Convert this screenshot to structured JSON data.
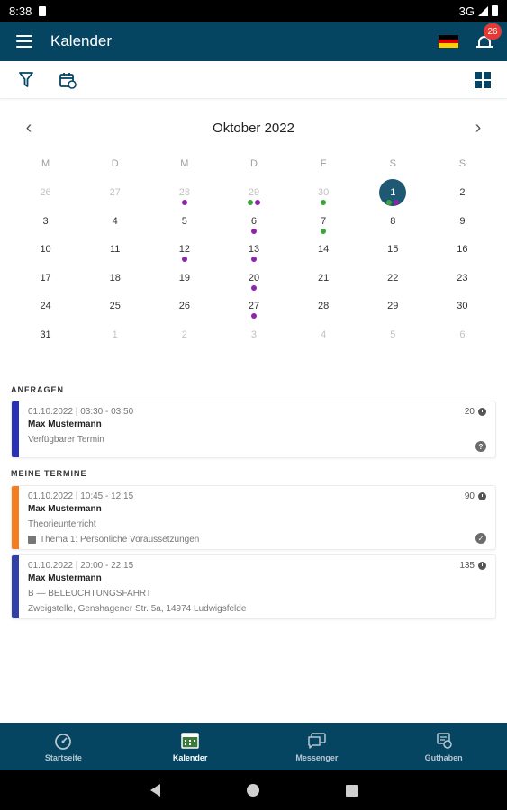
{
  "status_bar": {
    "time": "8:38",
    "network": "3G"
  },
  "app_bar": {
    "title": "Kalender",
    "notification_count": "26"
  },
  "calendar": {
    "month_title": "Oktober 2022",
    "weekdays": [
      "M",
      "D",
      "M",
      "D",
      "F",
      "S",
      "S"
    ],
    "days": [
      {
        "n": "26",
        "muted": true,
        "dots": []
      },
      {
        "n": "27",
        "muted": true,
        "dots": []
      },
      {
        "n": "28",
        "muted": true,
        "dots": [
          "purple"
        ]
      },
      {
        "n": "29",
        "muted": true,
        "dots": [
          "green",
          "purple"
        ]
      },
      {
        "n": "30",
        "muted": true,
        "dots": [
          "green"
        ]
      },
      {
        "n": "1",
        "muted": false,
        "selected": true,
        "dots": [
          "green",
          "purple"
        ]
      },
      {
        "n": "2",
        "muted": false,
        "dots": []
      },
      {
        "n": "3",
        "muted": false,
        "dots": []
      },
      {
        "n": "4",
        "muted": false,
        "dots": []
      },
      {
        "n": "5",
        "muted": false,
        "dots": []
      },
      {
        "n": "6",
        "muted": false,
        "dots": [
          "purple"
        ]
      },
      {
        "n": "7",
        "muted": false,
        "dots": [
          "green"
        ]
      },
      {
        "n": "8",
        "muted": false,
        "dots": []
      },
      {
        "n": "9",
        "muted": false,
        "dots": []
      },
      {
        "n": "10",
        "muted": false,
        "dots": []
      },
      {
        "n": "11",
        "muted": false,
        "dots": []
      },
      {
        "n": "12",
        "muted": false,
        "dots": [
          "purple"
        ]
      },
      {
        "n": "13",
        "muted": false,
        "dots": [
          "purple"
        ]
      },
      {
        "n": "14",
        "muted": false,
        "dots": []
      },
      {
        "n": "15",
        "muted": false,
        "dots": []
      },
      {
        "n": "16",
        "muted": false,
        "dots": []
      },
      {
        "n": "17",
        "muted": false,
        "dots": []
      },
      {
        "n": "18",
        "muted": false,
        "dots": []
      },
      {
        "n": "19",
        "muted": false,
        "dots": []
      },
      {
        "n": "20",
        "muted": false,
        "dots": [
          "purple"
        ]
      },
      {
        "n": "21",
        "muted": false,
        "dots": []
      },
      {
        "n": "22",
        "muted": false,
        "dots": []
      },
      {
        "n": "23",
        "muted": false,
        "dots": []
      },
      {
        "n": "24",
        "muted": false,
        "dots": []
      },
      {
        "n": "25",
        "muted": false,
        "dots": []
      },
      {
        "n": "26",
        "muted": false,
        "dots": []
      },
      {
        "n": "27",
        "muted": false,
        "dots": [
          "purple"
        ]
      },
      {
        "n": "28",
        "muted": false,
        "dots": []
      },
      {
        "n": "29",
        "muted": false,
        "dots": []
      },
      {
        "n": "30",
        "muted": false,
        "dots": []
      },
      {
        "n": "31",
        "muted": false,
        "dots": []
      },
      {
        "n": "1",
        "muted": true,
        "dots": []
      },
      {
        "n": "2",
        "muted": true,
        "dots": []
      },
      {
        "n": "3",
        "muted": true,
        "dots": []
      },
      {
        "n": "4",
        "muted": true,
        "dots": []
      },
      {
        "n": "5",
        "muted": true,
        "dots": []
      },
      {
        "n": "6",
        "muted": true,
        "dots": []
      }
    ]
  },
  "sections": {
    "requests_label": "ANFRAGEN",
    "appointments_label": "MEINE TERMINE"
  },
  "requests": [
    {
      "datetime": "01.10.2022 | 03:30 - 03:50",
      "name": "Max Mustermann",
      "subtitle": "Verfügbarer Termin",
      "duration": "20",
      "status_icon": "question-icon",
      "color": "#2a2fb8"
    }
  ],
  "appointments": [
    {
      "datetime": "01.10.2022 | 10:45 - 12:15",
      "name": "Max Mustermann",
      "subtitle": "Theorieunterricht",
      "detail": "Thema 1: Persönliche Voraussetzungen",
      "detail_icon": "book-icon",
      "duration": "90",
      "status_icon": "check-icon",
      "color": "#f57c1f"
    },
    {
      "datetime": "01.10.2022 | 20:00 - 22:15",
      "name": "Max Mustermann",
      "subtitle": "B — BELEUCHTUNGSFAHRT",
      "detail": "Zweigstelle, Genshagener Str. 5a, 14974 Ludwigsfelde",
      "duration": "135",
      "color": "#3140a8"
    }
  ],
  "bottom_nav": [
    {
      "label": "Startseite",
      "icon": "dashboard-icon",
      "active": false
    },
    {
      "label": "Kalender",
      "icon": "calendar-icon",
      "active": true
    },
    {
      "label": "Messenger",
      "icon": "chat-icon",
      "active": false
    },
    {
      "label": "Guthaben",
      "icon": "wallet-icon",
      "active": false
    }
  ],
  "colors": {
    "primary": "#064562",
    "selected_day": "#1e5873",
    "dot_green": "#3aa53a",
    "dot_purple": "#8e24aa"
  }
}
